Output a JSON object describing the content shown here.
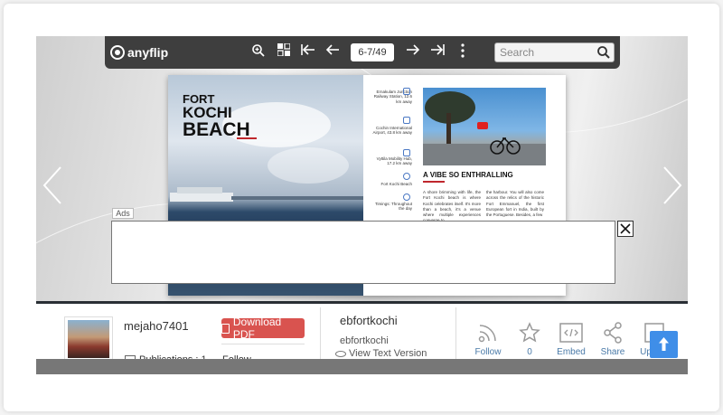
{
  "viewer": {
    "logo_text": "anyflip",
    "page_indicator": "6-7/49",
    "search_placeholder": "Search",
    "book": {
      "left_title_1": "FORT",
      "left_title_2": "KOCHI",
      "left_title_3": "BEACH",
      "facts": [
        "Ernakulam Junction Railway Station, 12.6 km away",
        "Cochin International Airport, 43.8 km away",
        "Vyttila Mobility Hub, 17.2 km away",
        "Fort Kochi Beach",
        "Timings: Throughout the day"
      ],
      "article_title": "A VIBE SO ENTHRALLING",
      "col1": "A shore brimming with life, the Fort Kochi beach is where Kochi celebrates itself. It's more than a beach, it's a venue where multiple experiences converge to",
      "col2": "the harbour. You will also come across the relics of the historic Fort Emmanuel, the first European fort in India, built by the Portuguese. Besides, a few"
    },
    "ads_label": "Ads"
  },
  "info": {
    "username": "mejaho7401",
    "download_label": "Download PDF",
    "publications_label": "Publications : 1",
    "follow_small": "Follow",
    "doc_title": "ebfortkochi",
    "doc_subtitle": "ebfortkochi",
    "view_text_label": "View Text Version",
    "actions": {
      "follow": "Follow",
      "likes": "0",
      "embed": "Embed",
      "share": "Share",
      "upload": "Upload"
    }
  },
  "colors": {
    "toolbar": "#3e3e3e",
    "download_button": "#d9534f",
    "accent_blue": "#3f8ee8",
    "action_text": "#4a7aa8",
    "title_red": "#c0272d"
  }
}
